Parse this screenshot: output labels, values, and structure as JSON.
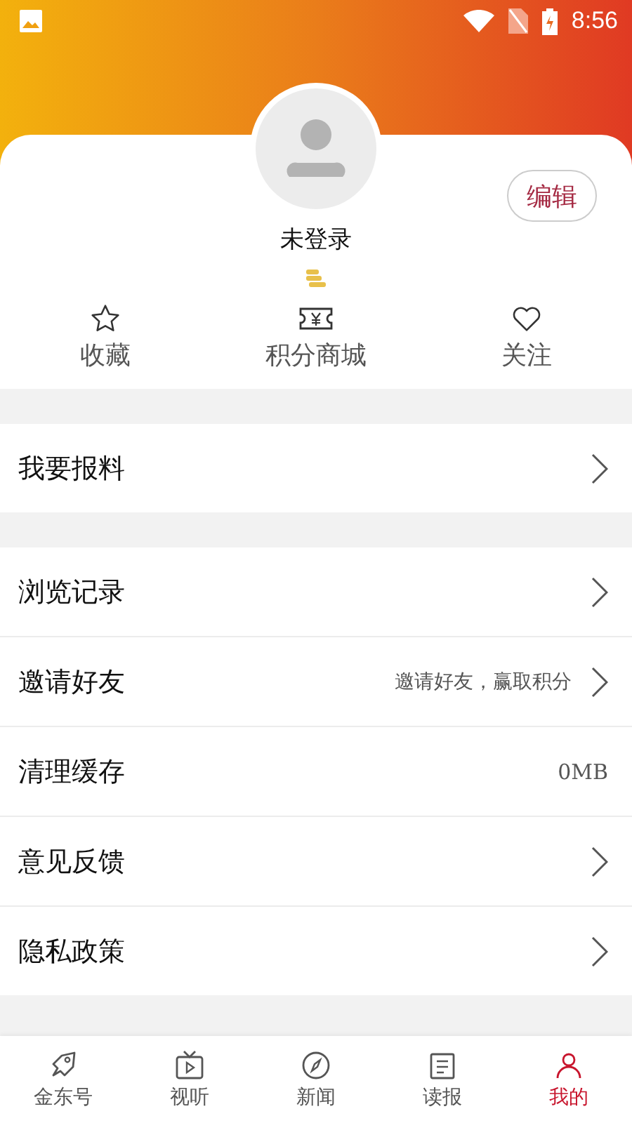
{
  "status_bar": {
    "time": "8:56"
  },
  "profile": {
    "name": "未登录",
    "edit_button": "编辑"
  },
  "shortcuts": [
    {
      "label": "收藏"
    },
    {
      "label": "积分商城"
    },
    {
      "label": "关注"
    }
  ],
  "sections": [
    [
      {
        "label": "我要报料",
        "kind": "arrow"
      }
    ],
    [
      {
        "label": "浏览记录",
        "kind": "arrow"
      },
      {
        "label": "邀请好友",
        "kind": "arrow",
        "hint": "邀请好友，赢取积分"
      },
      {
        "label": "清理缓存",
        "kind": "value",
        "value": "0MB"
      },
      {
        "label": "意见反馈",
        "kind": "arrow"
      },
      {
        "label": "隐私政策",
        "kind": "arrow"
      }
    ]
  ],
  "bottom_nav": [
    {
      "label": "金东号",
      "selected": false
    },
    {
      "label": "视听",
      "selected": false
    },
    {
      "label": "新闻",
      "selected": false
    },
    {
      "label": "读报",
      "selected": false
    },
    {
      "label": "我的",
      "selected": true
    }
  ]
}
